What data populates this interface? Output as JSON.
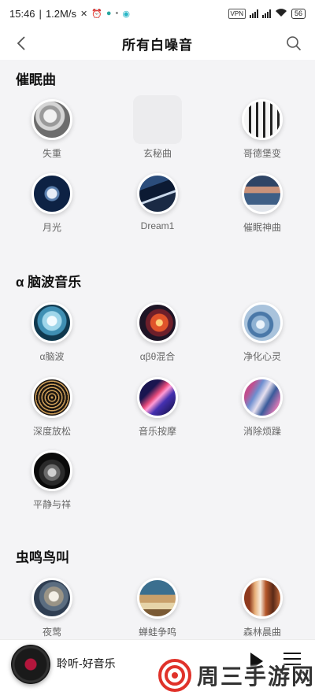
{
  "status_bar": {
    "time": "15:46",
    "speed": "1.2M/s",
    "vpn": "VPN",
    "battery": "56"
  },
  "nav": {
    "title": "所有白噪音"
  },
  "sections": [
    {
      "title": "催眠曲",
      "items": [
        {
          "label": "失重",
          "thumb": "astronaut"
        },
        {
          "label": "玄秘曲",
          "thumb": "blank"
        },
        {
          "label": "哥德堡变",
          "thumb": "piano"
        },
        {
          "label": "月光",
          "thumb": "moon"
        },
        {
          "label": "Dream1",
          "thumb": "night-mountain"
        },
        {
          "label": "催眠神曲",
          "thumb": "lake-sunset"
        }
      ]
    },
    {
      "title": "α 脑波音乐",
      "items": [
        {
          "label": "α脑波",
          "thumb": "brain-blue"
        },
        {
          "label": "αβθ混合",
          "thumb": "brain-red"
        },
        {
          "label": "净化心灵",
          "thumb": "water-blue"
        },
        {
          "label": "深度放松",
          "thumb": "mandala"
        },
        {
          "label": "音乐按摩",
          "thumb": "light-streak"
        },
        {
          "label": "消除烦躁",
          "thumb": "fluid-art"
        },
        {
          "label": "平静与祥",
          "thumb": "smoke"
        }
      ]
    },
    {
      "title": "虫鸣鸟叫",
      "items": [
        {
          "label": "夜莺",
          "thumb": "nightingale"
        },
        {
          "label": "蝉蛙争鸣",
          "thumb": "frog"
        },
        {
          "label": "森林晨曲",
          "thumb": "forest"
        }
      ]
    }
  ],
  "player": {
    "now_playing": "聆听-好音乐"
  },
  "watermark": {
    "text": "周三手游网"
  },
  "colors": {
    "background": "#f4f4f6",
    "card_bg": "#ffffff",
    "label_gray": "#666666",
    "disc_red": "#b4163c"
  }
}
